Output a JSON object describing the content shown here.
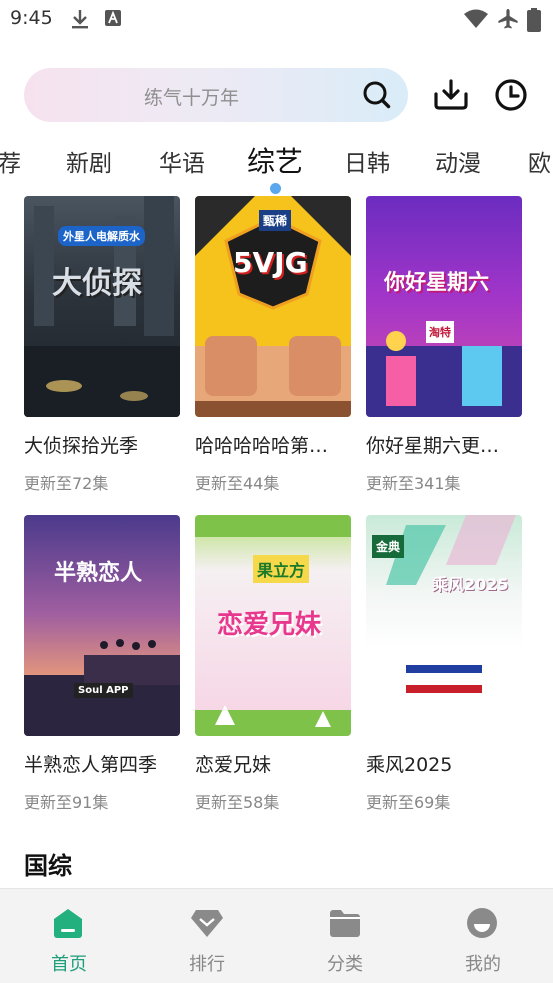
{
  "status_bar": {
    "time": "9:45"
  },
  "search": {
    "placeholder": "练气十万年"
  },
  "tabs": [
    {
      "label": "荐"
    },
    {
      "label": "新剧"
    },
    {
      "label": "华语"
    },
    {
      "label": "综艺",
      "active": true
    },
    {
      "label": "日韩"
    },
    {
      "label": "动漫"
    },
    {
      "label": "欧"
    }
  ],
  "cards": [
    {
      "title": "大侦探拾光季",
      "subtitle": "更新至72集",
      "poster_text": "大侦探",
      "poster_badge": "外星人电解质水"
    },
    {
      "title": "哈哈哈哈哈第…",
      "subtitle": "更新至44集",
      "poster_text": "5VJG",
      "poster_badge": "甄稀"
    },
    {
      "title": "你好星期六更…",
      "subtitle": "更新至341集",
      "poster_text": "你好星期六",
      "poster_badge": "淘特"
    },
    {
      "title": "半熟恋人第四季",
      "subtitle": "更新至91集",
      "poster_text": "半熟恋人",
      "poster_badge": "Soul APP"
    },
    {
      "title": "恋爱兄妹",
      "subtitle": "更新至58集",
      "poster_text": "恋爱兄妹",
      "poster_badge": "果立方"
    },
    {
      "title": "乘风2025",
      "subtitle": "更新至69集",
      "poster_text": "乘风2025",
      "poster_badge": "金典"
    }
  ],
  "section": {
    "title": "国综"
  },
  "bottom_nav": [
    {
      "label": "首页",
      "icon": "home-icon",
      "active": true
    },
    {
      "label": "排行",
      "icon": "ranking-icon"
    },
    {
      "label": "分类",
      "icon": "folder-icon"
    },
    {
      "label": "我的",
      "icon": "profile-icon"
    }
  ],
  "colors": {
    "accent": "#1f9e7a",
    "indicator": "#5aa7ee"
  }
}
